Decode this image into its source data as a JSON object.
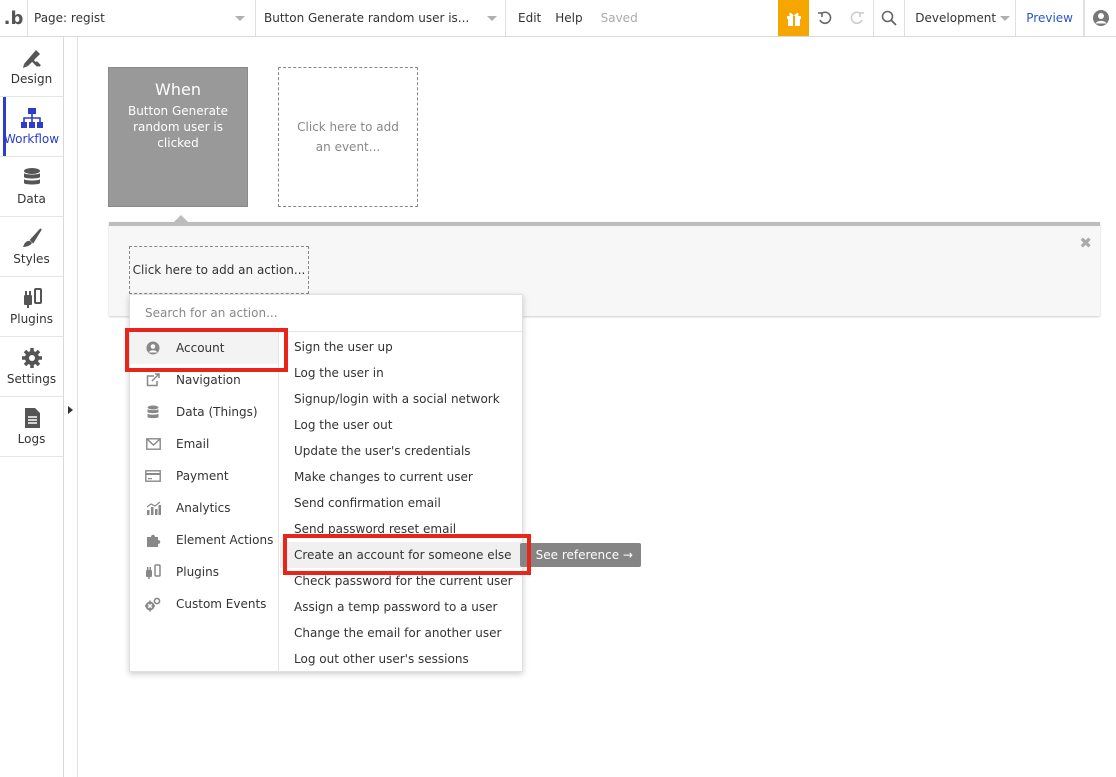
{
  "topbar": {
    "logo": ".b",
    "page_label": "Page: regist",
    "event_label": "Button Generate random user is...",
    "edit": "Edit",
    "help": "Help",
    "saved": "Saved",
    "environment": "Development",
    "preview": "Preview"
  },
  "sidebar": {
    "items": [
      {
        "label": "Design",
        "icon": "design-icon"
      },
      {
        "label": "Workflow",
        "icon": "workflow-icon",
        "active": true
      },
      {
        "label": "Data",
        "icon": "database-icon"
      },
      {
        "label": "Styles",
        "icon": "brush-icon"
      },
      {
        "label": "Plugins",
        "icon": "plug-icon"
      },
      {
        "label": "Settings",
        "icon": "gear-icon"
      },
      {
        "label": "Logs",
        "icon": "document-icon"
      }
    ]
  },
  "workflow": {
    "when_title": "When",
    "when_subtitle": "Button Generate random user is clicked",
    "add_event": "Click here to add an event...",
    "add_action": "Click here to add an action...",
    "close": "✖"
  },
  "dropdown": {
    "search_placeholder": "Search for an action...",
    "categories": [
      {
        "label": "Account",
        "icon": "user-circle-icon"
      },
      {
        "label": "Navigation",
        "icon": "external-link-icon"
      },
      {
        "label": "Data (Things)",
        "icon": "database-icon"
      },
      {
        "label": "Email",
        "icon": "envelope-icon"
      },
      {
        "label": "Payment",
        "icon": "credit-card-icon"
      },
      {
        "label": "Analytics",
        "icon": "bar-chart-icon"
      },
      {
        "label": "Element Actions",
        "icon": "puzzle-icon"
      },
      {
        "label": "Plugins",
        "icon": "plug-icon"
      },
      {
        "label": "Custom Events",
        "icon": "gears-icon"
      }
    ],
    "actions": [
      "Sign the user up",
      "Log the user in",
      "Signup/login with a social network",
      "Log the user out",
      "Update the user's credentials",
      "Make changes to current user",
      "Send confirmation email",
      "Send password reset email",
      "Create an account for someone else",
      "Check password for the current user",
      "Assign a temp password to a user",
      "Change the email for another user",
      "Log out other user's sessions"
    ],
    "see_reference": "See reference →"
  },
  "colors": {
    "accent": "#2b3ccf",
    "gift": "#f7a600",
    "highlight": "#e8251b",
    "card": "#999999"
  }
}
